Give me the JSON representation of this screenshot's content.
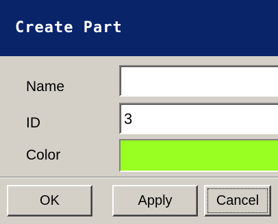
{
  "window": {
    "title": "Create Part"
  },
  "form": {
    "name_label": "Name",
    "name_value": "",
    "id_label": "ID",
    "id_value": "3",
    "color_label": "Color",
    "color_value": "#99ff22"
  },
  "buttons": {
    "ok_label": "OK",
    "apply_label": "Apply",
    "cancel_label": "Cancel"
  },
  "colors": {
    "titlebar": "#0a246a",
    "dialog_bg": "#d4d0c8"
  }
}
